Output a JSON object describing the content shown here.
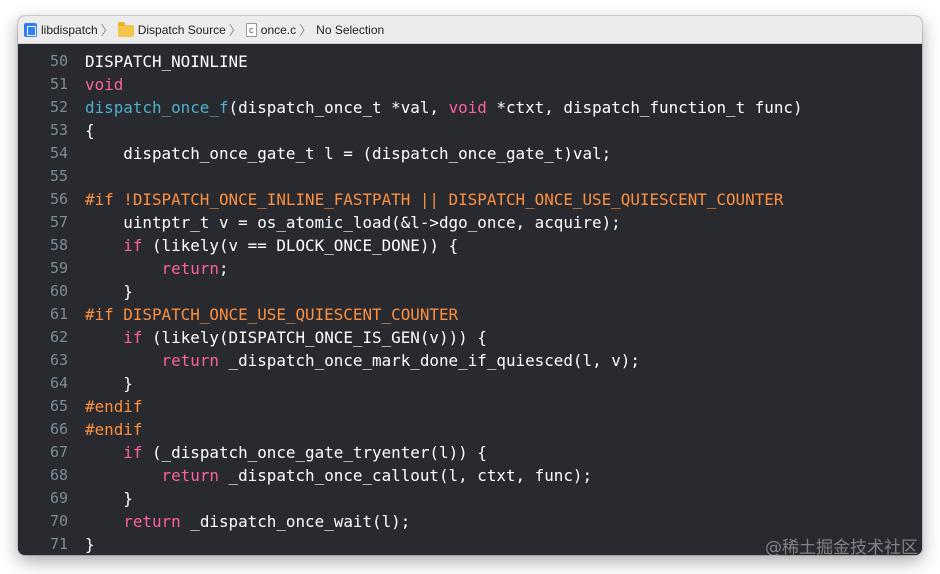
{
  "jumpbar": {
    "items": [
      {
        "label": "libdispatch",
        "icon": "project-icon"
      },
      {
        "label": "Dispatch Source",
        "icon": "folder-icon"
      },
      {
        "label": "once.c",
        "icon": "c-file-icon"
      },
      {
        "label": "No Selection",
        "icon": ""
      }
    ],
    "c_file_glyph": "c"
  },
  "colors": {
    "keyword": "#fc5fa3",
    "function": "#4eb0cc",
    "preprocessor": "#fd8f3f",
    "plain": "#ffffff",
    "line_number": "#7f8c98",
    "background": "#292a30"
  },
  "editor": {
    "lines": [
      {
        "number": "50",
        "tokens": [
          {
            "t": "DISPATCH_NOINLINE",
            "c": "plain"
          }
        ]
      },
      {
        "number": "51",
        "tokens": [
          {
            "t": "void",
            "c": "kw"
          }
        ]
      },
      {
        "number": "52",
        "tokens": [
          {
            "t": "dispatch_once_f",
            "c": "fn"
          },
          {
            "t": "(dispatch_once_t *val, ",
            "c": "plain"
          },
          {
            "t": "void",
            "c": "kw"
          },
          {
            "t": " *ctxt, dispatch_function_t func)",
            "c": "plain"
          }
        ]
      },
      {
        "number": "53",
        "tokens": [
          {
            "t": "{",
            "c": "plain"
          }
        ]
      },
      {
        "number": "54",
        "tokens": [
          {
            "t": "    dispatch_once_gate_t l = (dispatch_once_gate_t)val;",
            "c": "plain"
          }
        ]
      },
      {
        "number": "55",
        "tokens": []
      },
      {
        "number": "56",
        "tokens": [
          {
            "t": "#if !DISPATCH_ONCE_INLINE_FASTPATH || DISPATCH_ONCE_USE_QUIESCENT_COUNTER",
            "c": "pp"
          }
        ]
      },
      {
        "number": "57",
        "tokens": [
          {
            "t": "    uintptr_t v = os_atomic_load(&l->dgo_once, acquire);",
            "c": "plain"
          }
        ]
      },
      {
        "number": "58",
        "tokens": [
          {
            "t": "    ",
            "c": "plain"
          },
          {
            "t": "if",
            "c": "kw"
          },
          {
            "t": " (likely(v == DLOCK_ONCE_DONE)) {",
            "c": "plain"
          }
        ]
      },
      {
        "number": "59",
        "tokens": [
          {
            "t": "        ",
            "c": "plain"
          },
          {
            "t": "return",
            "c": "kw"
          },
          {
            "t": ";",
            "c": "plain"
          }
        ]
      },
      {
        "number": "60",
        "tokens": [
          {
            "t": "    }",
            "c": "plain"
          }
        ]
      },
      {
        "number": "61",
        "tokens": [
          {
            "t": "#if DISPATCH_ONCE_USE_QUIESCENT_COUNTER",
            "c": "pp"
          }
        ]
      },
      {
        "number": "62",
        "tokens": [
          {
            "t": "    ",
            "c": "plain"
          },
          {
            "t": "if",
            "c": "kw"
          },
          {
            "t": " (likely(DISPATCH_ONCE_IS_GEN(v))) {",
            "c": "plain"
          }
        ]
      },
      {
        "number": "63",
        "tokens": [
          {
            "t": "        ",
            "c": "plain"
          },
          {
            "t": "return",
            "c": "kw"
          },
          {
            "t": " _dispatch_once_mark_done_if_quiesced(l, v);",
            "c": "plain"
          }
        ]
      },
      {
        "number": "64",
        "tokens": [
          {
            "t": "    }",
            "c": "plain"
          }
        ]
      },
      {
        "number": "65",
        "tokens": [
          {
            "t": "#endif",
            "c": "pp"
          }
        ]
      },
      {
        "number": "66",
        "tokens": [
          {
            "t": "#endif",
            "c": "pp"
          }
        ]
      },
      {
        "number": "67",
        "tokens": [
          {
            "t": "    ",
            "c": "plain"
          },
          {
            "t": "if",
            "c": "kw"
          },
          {
            "t": " (_dispatch_once_gate_tryenter(l)) {",
            "c": "plain"
          }
        ]
      },
      {
        "number": "68",
        "tokens": [
          {
            "t": "        ",
            "c": "plain"
          },
          {
            "t": "return",
            "c": "kw"
          },
          {
            "t": " _dispatch_once_callout(l, ctxt, func);",
            "c": "plain"
          }
        ]
      },
      {
        "number": "69",
        "tokens": [
          {
            "t": "    }",
            "c": "plain"
          }
        ]
      },
      {
        "number": "70",
        "tokens": [
          {
            "t": "    ",
            "c": "plain"
          },
          {
            "t": "return",
            "c": "kw"
          },
          {
            "t": " _dispatch_once_wait(l);",
            "c": "plain"
          }
        ]
      },
      {
        "number": "71",
        "tokens": [
          {
            "t": "}",
            "c": "plain"
          }
        ]
      }
    ]
  },
  "watermark": "@稀土掘金技术社区"
}
